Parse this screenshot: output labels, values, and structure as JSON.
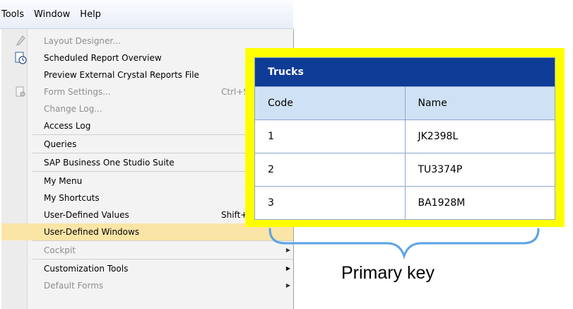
{
  "menubar": {
    "items": [
      "Tools",
      "Window",
      "Help"
    ],
    "mnemonics": [
      "T",
      "W",
      "H"
    ]
  },
  "menu": {
    "items": [
      {
        "label": "Layout Designer...",
        "disabled": true,
        "icon": "pencil-icon"
      },
      {
        "label": "Scheduled Report Overview",
        "icon": "report-schedule-icon"
      },
      {
        "label": "Preview External Crystal Reports File"
      },
      {
        "label": "Form Settings...",
        "shortcut": "Ctrl+S",
        "disabled": true,
        "icon": "form-settings-icon"
      },
      {
        "label": "Change Log...",
        "disabled": true
      },
      {
        "label": "Access Log"
      },
      {
        "label": "Queries"
      },
      {
        "label": "SAP Business One Studio Suite"
      },
      {
        "label": "My Menu"
      },
      {
        "label": "My Shortcuts"
      },
      {
        "label": "User-Defined Values",
        "shortcut": "Shift+"
      },
      {
        "label": "User-Defined Windows",
        "highlighted": true
      },
      {
        "label": "Cockpit",
        "disabled": true,
        "submenu": true
      },
      {
        "label": "Customization Tools",
        "submenu": true
      },
      {
        "label": "Default Forms",
        "disabled": true,
        "submenu": true
      }
    ]
  },
  "table": {
    "title": "Trucks",
    "columns": [
      "Code",
      "Name"
    ],
    "rows": [
      [
        "1",
        "JK2398L"
      ],
      [
        "2",
        "TU3374P"
      ],
      [
        "3",
        "BA1928M"
      ]
    ]
  },
  "annotation": {
    "label": "Primary key"
  },
  "colors": {
    "callout": "#ffff00",
    "table_title": "#0f3c97",
    "table_header": "#cfe2f5",
    "menu_highlight": "#fbe5a6",
    "brace": "#5aa3e6"
  }
}
